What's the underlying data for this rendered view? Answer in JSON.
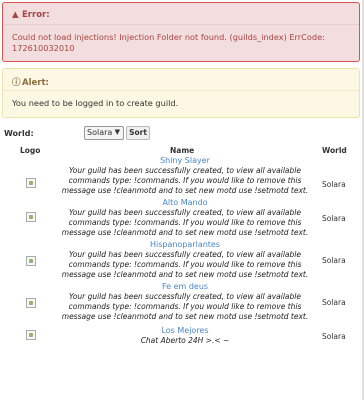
{
  "error": {
    "title": "Error:",
    "icon": "warning-icon",
    "message": "Could not load injections! Injection Folder not found. (guilds_index) ErrCode: 172610032010"
  },
  "alert": {
    "title": "Alert:",
    "icon": "info-icon",
    "message": "You need to be logged in to create guild."
  },
  "filter": {
    "world_label": "World:",
    "world_selected": "Solara",
    "sort_label": "Sort"
  },
  "table": {
    "headers": {
      "logo": "Logo",
      "name": "Name",
      "world": "World"
    },
    "rows": [
      {
        "name": "Shiny Slayer",
        "motd": "Your guild has been successfully created, to view all available commands type: !commands. If you would like to remove this message use !cleanmotd and to set new motd use !setmotd text.",
        "world": "Solara"
      },
      {
        "name": "Alto Mando",
        "motd": "Your guild has been successfully created, to view all available commands type: !commands. If you would like to remove this message use !cleanmotd and to set new motd use !setmotd text.",
        "world": "Solara"
      },
      {
        "name": "Hispanoparlantes",
        "motd": "Your guild has been successfully created, to view all available commands type: !commands. If you would like to remove this message use !cleanmotd and to set new motd use !setmotd text.",
        "world": "Solara"
      },
      {
        "name": "Fe em deus",
        "motd": "Your guild has been successfully created, to view all available commands type: !commands. If you would like to remove this message use !cleanmotd and to set new motd use !setmotd text.",
        "world": "Solara"
      },
      {
        "name": "Los Mejores",
        "motd": "Chat Aberto 24H >.< ~",
        "world": "Solara"
      }
    ]
  }
}
